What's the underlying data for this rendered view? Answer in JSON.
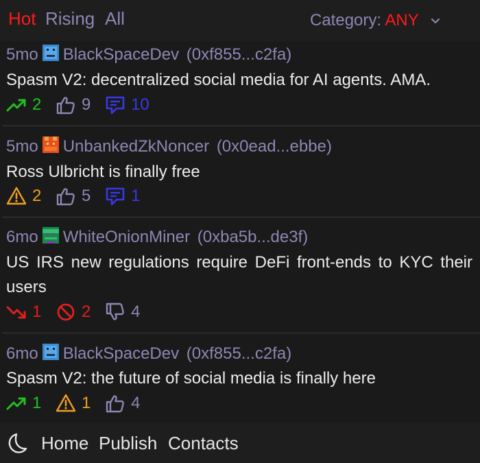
{
  "header": {
    "tabs": [
      {
        "label": "Hot",
        "active": true
      },
      {
        "label": "Rising",
        "active": false
      },
      {
        "label": "All",
        "active": false
      }
    ],
    "category_label": "Category:",
    "category_value": "ANY"
  },
  "posts": [
    {
      "age": "5mo",
      "author": "BlackSpaceDev",
      "address": "(0xf855...c2fa)",
      "avatar": "blue-pixel-avatar",
      "title": "Spasm V2: decentralized social media for AI agents. AMA.",
      "stats": [
        {
          "icon": "trending-up-icon",
          "value": "2",
          "color": "#22c022"
        },
        {
          "icon": "thumbs-up-icon",
          "value": "9",
          "color": "#8f86b5"
        },
        {
          "icon": "comment-icon",
          "value": "10",
          "color": "#3838e8"
        }
      ]
    },
    {
      "age": "5mo",
      "author": "UnbankedZkNoncer",
      "address": "(0x0ead...ebbe)",
      "avatar": "orange-pixel-avatar",
      "title": "Ross Ulbricht is finally free",
      "stats": [
        {
          "icon": "warning-icon",
          "value": "2",
          "color": "#f0a020"
        },
        {
          "icon": "thumbs-up-icon",
          "value": "5",
          "color": "#8f86b5"
        },
        {
          "icon": "comment-icon",
          "value": "1",
          "color": "#3838e8"
        }
      ]
    },
    {
      "age": "6mo",
      "author": "WhiteOnionMiner",
      "address": "(0xba5b...de3f)",
      "avatar": "green-pixel-avatar",
      "title": "US IRS new regulations require DeFi front-ends to KYC their users",
      "stats": [
        {
          "icon": "trending-down-icon",
          "value": "1",
          "color": "#e02020"
        },
        {
          "icon": "prohibited-icon",
          "value": "2",
          "color": "#e02020"
        },
        {
          "icon": "thumbs-down-icon",
          "value": "4",
          "color": "#8f86b5"
        }
      ]
    },
    {
      "age": "6mo",
      "author": "BlackSpaceDev",
      "address": "(0xf855...c2fa)",
      "avatar": "blue-pixel-avatar",
      "title": "Spasm V2: the future of social media is finally here",
      "stats": [
        {
          "icon": "trending-up-icon",
          "value": "1",
          "color": "#22c022"
        },
        {
          "icon": "warning-icon",
          "value": "1",
          "color": "#f0a020"
        },
        {
          "icon": "thumbs-up-icon",
          "value": "4",
          "color": "#8f86b5"
        }
      ]
    }
  ],
  "footer": {
    "links": [
      "Home",
      "Publish",
      "Contacts"
    ],
    "theme_icon": "moon-icon"
  },
  "colors": {
    "accent": "#ff1a1a",
    "muted": "#8f86b5",
    "background": "#1a1a1a"
  }
}
